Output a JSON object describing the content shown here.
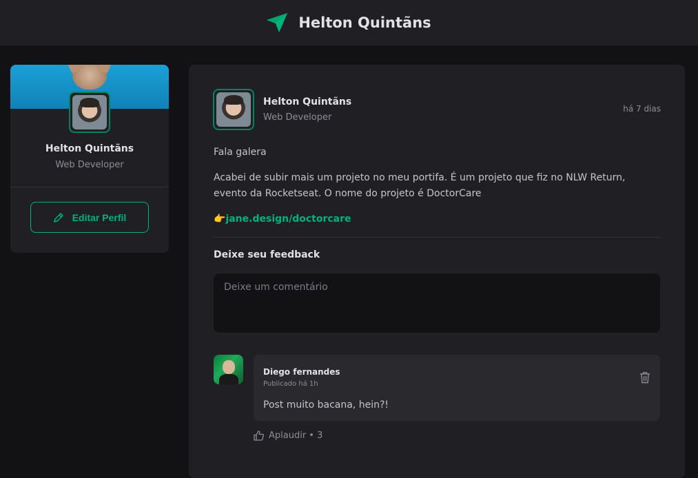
{
  "header": {
    "title": "Helton Quintãns",
    "logo_icon": "paper-plane-icon"
  },
  "sidebar": {
    "name": "Helton Quintãns",
    "role": "Web Developer",
    "edit_button": "Editar Perfil",
    "edit_icon": "pencil-icon"
  },
  "post": {
    "author": {
      "name": "Helton Quintãns",
      "role": "Web Developer"
    },
    "time": "há 7 dias",
    "content": {
      "greeting": "Fala galera",
      "body": "Acabei de subir mais um projeto no meu portifa. É um projeto que fiz no NLW Return, evento da Rocketseat. O nome do projeto é DoctorCare",
      "link_emoji": "👉",
      "link_text": "jane.design/doctorcare"
    },
    "feedback": {
      "title": "Deixe seu feedback",
      "placeholder": "Deixe um comentário"
    },
    "comments": [
      {
        "author": "Diego fernandes",
        "time": "Publicado há 1h",
        "text": "Post muito bacana, hein?!",
        "applaud_label": "Aplaudir",
        "applaud_separator": " • ",
        "applaud_count": "3"
      }
    ]
  },
  "colors": {
    "accent": "#00b37e",
    "background": "#121214",
    "surface": "#202024"
  }
}
